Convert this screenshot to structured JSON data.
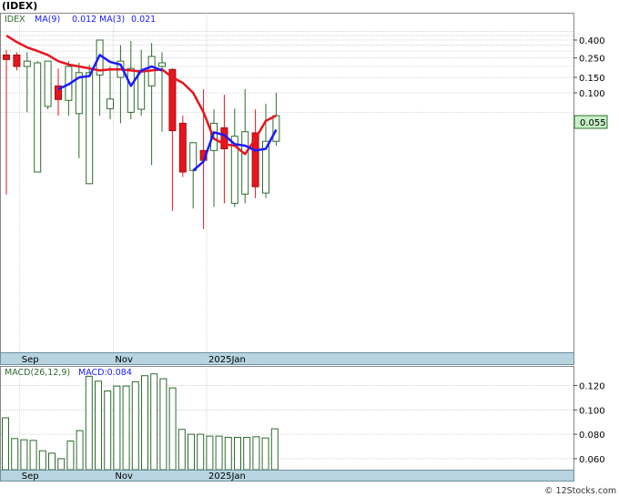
{
  "title": "(IDEX)",
  "watermark": "© 12Stocks.com",
  "colors": {
    "up_fill": "#ffffff",
    "up_stroke": "#2e6b2e",
    "down_fill": "#e8141e",
    "ma9": "#1a1aff",
    "ma3": "#e8141e",
    "grid": "#b8b8b8",
    "axis_band": "#b7d4e0",
    "price_tag_bg": "#c8f0c8",
    "macd_bar": "#2e6b2e"
  },
  "chart_data": [
    {
      "type": "candlestick",
      "legend": [
        {
          "label": "IDEX",
          "color": "#2e6b2e"
        },
        {
          "label": "MA(9)",
          "value": "0.012",
          "color": "#1a1aff"
        },
        {
          "label": "MA(3)",
          "value": "0.021",
          "color": "#1a1aff"
        }
      ],
      "y_scale": "log",
      "y_ticks": [
        "0.400",
        "0.250",
        "0.150",
        "0.100"
      ],
      "last_price_label": "0.055",
      "x_labels": [
        {
          "label": "Sep",
          "index": 2
        },
        {
          "label": "Nov",
          "index": 11
        },
        {
          "label": "2025Jan",
          "index": 20
        }
      ],
      "candles": [
        {
          "o": 0.27,
          "h": 0.31,
          "l": 0.0069,
          "c": 0.24
        },
        {
          "o": 0.27,
          "h": 0.29,
          "l": 0.18,
          "c": 0.2
        },
        {
          "o": 0.2,
          "h": 0.29,
          "l": 0.06,
          "c": 0.23
        },
        {
          "o": 0.0125,
          "h": 0.23,
          "l": 0.0125,
          "c": 0.22
        },
        {
          "o": 0.07,
          "h": 0.23,
          "l": 0.065,
          "c": 0.23
        },
        {
          "o": 0.12,
          "h": 0.19,
          "l": 0.055,
          "c": 0.084
        },
        {
          "o": 0.082,
          "h": 0.23,
          "l": 0.055,
          "c": 0.2
        },
        {
          "o": 0.058,
          "h": 0.22,
          "l": 0.018,
          "c": 0.17
        },
        {
          "o": 0.0092,
          "h": 0.21,
          "l": 0.0092,
          "c": 0.17
        },
        {
          "o": 0.16,
          "h": 0.23,
          "l": 0.055,
          "c": 0.4
        },
        {
          "o": 0.066,
          "h": 0.2,
          "l": 0.05,
          "c": 0.085
        },
        {
          "o": 0.15,
          "h": 0.35,
          "l": 0.045,
          "c": 0.23
        },
        {
          "o": 0.06,
          "h": 0.39,
          "l": 0.05,
          "c": 0.19
        },
        {
          "o": 0.065,
          "h": 0.31,
          "l": 0.055,
          "c": 0.18
        },
        {
          "o": 0.12,
          "h": 0.37,
          "l": 0.015,
          "c": 0.26
        },
        {
          "o": 0.2,
          "h": 0.29,
          "l": 0.036,
          "c": 0.22
        },
        {
          "o": 0.185,
          "h": 0.19,
          "l": 0.0045,
          "c": 0.037
        },
        {
          "o": 0.045,
          "h": 0.055,
          "l": 0.011,
          "c": 0.0125
        },
        {
          "o": 0.013,
          "h": 0.026,
          "l": 0.0048,
          "c": 0.027
        },
        {
          "o": 0.022,
          "h": 0.11,
          "l": 0.0028,
          "c": 0.017
        },
        {
          "o": 0.022,
          "h": 0.065,
          "l": 0.005,
          "c": 0.045
        },
        {
          "o": 0.04,
          "h": 0.095,
          "l": 0.0055,
          "c": 0.023
        },
        {
          "o": 0.0055,
          "h": 0.066,
          "l": 0.005,
          "c": 0.032
        },
        {
          "o": 0.007,
          "h": 0.11,
          "l": 0.0055,
          "c": 0.036
        },
        {
          "o": 0.035,
          "h": 0.065,
          "l": 0.0063,
          "c": 0.0085
        },
        {
          "o": 0.0072,
          "h": 0.075,
          "l": 0.0063,
          "c": 0.028
        },
        {
          "o": 0.028,
          "h": 0.1,
          "l": 0.025,
          "c": 0.055
        }
      ],
      "ma3": [
        0.45,
        0.38,
        0.33,
        0.3,
        0.27,
        0.23,
        0.21,
        0.2,
        0.19,
        0.18,
        0.185,
        0.185,
        0.18,
        0.175,
        0.18,
        0.185,
        0.15,
        0.13,
        0.1,
        0.06,
        0.03,
        0.026,
        0.025,
        0.02,
        0.03,
        0.048,
        0.055
      ],
      "ma9": [
        null,
        null,
        null,
        null,
        null,
        0.11,
        0.125,
        0.15,
        0.155,
        0.27,
        0.225,
        0.21,
        0.12,
        0.18,
        0.2,
        0.18,
        null,
        null,
        0.013,
        0.0165,
        0.0355,
        0.033,
        0.026,
        0.025,
        0.022,
        0.023,
        0.038
      ]
    },
    {
      "type": "bar",
      "legend": [
        {
          "label": "MACD(26,12,9)",
          "color": "#2e6b2e"
        },
        {
          "label": "MACD:0.084",
          "color": "#1a1aff"
        }
      ],
      "y_ticks": [
        "0.120",
        "0.100",
        "0.080",
        "0.060"
      ],
      "ylim": [
        0.051,
        0.136
      ],
      "x_labels": [
        {
          "label": "Sep",
          "index": 2
        },
        {
          "label": "Nov",
          "index": 11
        },
        {
          "label": "2025Jan",
          "index": 20
        }
      ],
      "values": [
        0.0935,
        0.0765,
        0.0755,
        0.075,
        0.0665,
        0.0645,
        0.06,
        0.0745,
        0.083,
        0.1275,
        0.1235,
        0.1155,
        0.1195,
        0.1195,
        0.123,
        0.128,
        0.1295,
        0.1255,
        0.118,
        0.084,
        0.08,
        0.08,
        0.0785,
        0.0785,
        0.0775,
        0.0775,
        0.0775,
        0.078,
        0.077,
        0.0845
      ]
    }
  ]
}
